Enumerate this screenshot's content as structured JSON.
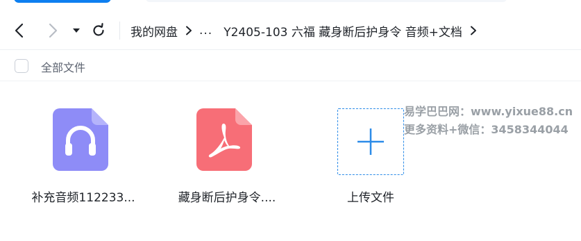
{
  "topbar": {
    "accent_color": "#0d7ff0"
  },
  "nav": {
    "back_icon": "chevron-left-icon",
    "forward_icon": "chevron-right-icon",
    "dropdown_icon": "caret-down-icon",
    "refresh_icon": "refresh-icon"
  },
  "breadcrumb": {
    "root": "我的网盘",
    "ellipsis": "...",
    "current": "Y2405-103 六福 藏身断后护身令 音频+文档"
  },
  "selection": {
    "select_all_label": "全部文件"
  },
  "files": [
    {
      "name": "补充音频112233...",
      "icon": "audio-file-icon",
      "color": "#8e8cf7"
    },
    {
      "name": "藏身断后护身令....",
      "icon": "pdf-file-icon",
      "color": "#f76e77"
    }
  ],
  "upload": {
    "label": "上传文件",
    "icon": "plus-icon",
    "color": "#2b8be8"
  },
  "watermark": {
    "line1": "易学巴巴网：www.yixue88.cn",
    "line2": "更多资料+微信：3458344044"
  }
}
